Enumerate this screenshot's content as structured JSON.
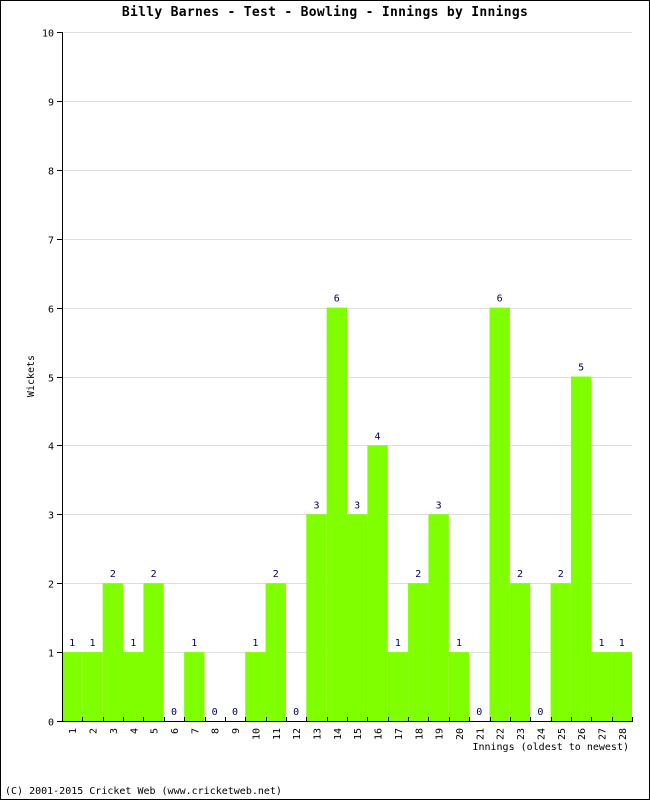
{
  "chart_data": {
    "type": "bar",
    "title": "Billy Barnes - Test - Bowling - Innings by Innings",
    "xlabel": "Innings (oldest to newest)",
    "ylabel": "Wickets",
    "ylim": [
      0,
      10
    ],
    "yticks": [
      0,
      1,
      2,
      3,
      4,
      5,
      6,
      7,
      8,
      9,
      10
    ],
    "grid": true,
    "bar_color": "#80ff00",
    "value_label_color": "#000066",
    "categories": [
      "1",
      "2",
      "3",
      "4",
      "5",
      "6",
      "7",
      "8",
      "9",
      "10",
      "11",
      "12",
      "13",
      "14",
      "15",
      "16",
      "17",
      "18",
      "19",
      "20",
      "21",
      "22",
      "23",
      "24",
      "25",
      "26",
      "27",
      "28"
    ],
    "values": [
      1,
      1,
      2,
      1,
      2,
      0,
      1,
      0,
      0,
      1,
      2,
      0,
      3,
      6,
      3,
      4,
      1,
      2,
      3,
      1,
      0,
      6,
      2,
      0,
      2,
      5,
      1,
      1
    ]
  },
  "footer": "(C) 2001-2015 Cricket Web (www.cricketweb.net)"
}
